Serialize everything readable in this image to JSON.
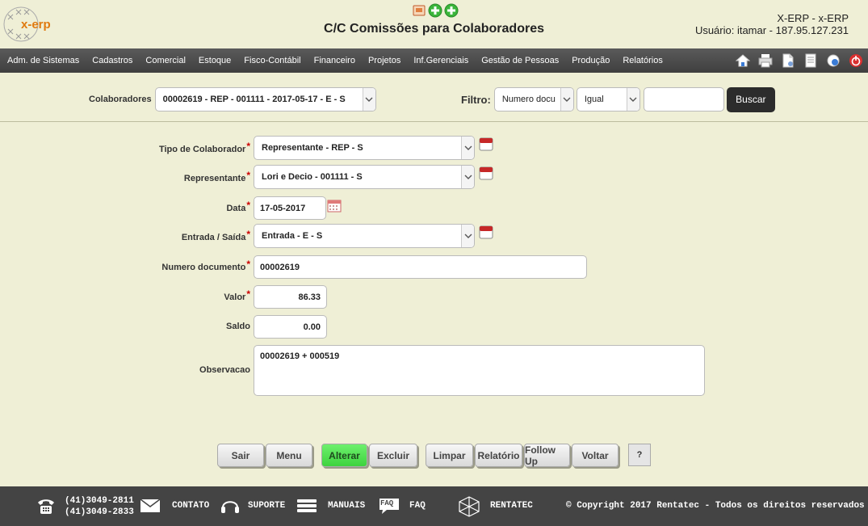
{
  "header": {
    "logo_text": "x-erp",
    "page_title": "C/C Comissões para Colaboradores",
    "system": "X-ERP - x-ERP",
    "user_info": "Usuário: itamar - 187.95.127.231"
  },
  "menu": {
    "items": [
      "Adm. de Sistemas",
      "Cadastros",
      "Comercial",
      "Estoque",
      "Fisco-Contábil",
      "Financeiro",
      "Projetos",
      "Inf.Gerenciais",
      "Gestão de Pessoas",
      "Produção",
      "Relatórios"
    ]
  },
  "filter": {
    "colaboradores_label": "Colaboradores",
    "colaboradores_value": "00002619 - REP - 001111 - 2017-05-17 - E - S",
    "filtro_label": "Filtro:",
    "field_value": "Numero docu",
    "operator_value": "Igual",
    "search_value": "",
    "buscar_label": "Buscar"
  },
  "form": {
    "tipo_label": "Tipo de Colaborador",
    "tipo_value": "Representante - REP - S",
    "representante_label": "Representante",
    "representante_value": "Lori e Decio - 001111 - S",
    "data_label": "Data",
    "data_value": "17-05-2017",
    "entrada_label": "Entrada / Saída",
    "entrada_value": "Entrada - E - S",
    "numero_label": "Numero documento",
    "numero_value": "00002619",
    "valor_label": "Valor",
    "valor_value": "86.33",
    "saldo_label": "Saldo",
    "saldo_value": "0.00",
    "obs_label": "Observacao",
    "obs_value": "00002619 + 000519",
    "required_mark": "*"
  },
  "actions": {
    "sair": "Sair",
    "menu": "Menu",
    "alterar": "Alterar",
    "excluir": "Excluir",
    "limpar": "Limpar",
    "relatorio": "Relatório",
    "followup": "Follow Up",
    "voltar": "Voltar",
    "help": "?"
  },
  "footer": {
    "phone1": "(41)3049-2811",
    "phone2": "(41)3049-2833",
    "contato": "CONTATO",
    "suporte": "SUPORTE",
    "manuais": "MANUAIS",
    "faq": "FAQ",
    "faq_icon_text": "FAQ",
    "rentatec": "RENTATEC",
    "copyright": "© Copyright 2017 Rentatec - Todos os direitos reservados"
  },
  "colors": {
    "background": "#efefd6",
    "menubar": "#4a4a4a",
    "alterar_button": "#4fe04f",
    "required": "#cc0000",
    "footer": "#444444"
  },
  "icons": {
    "top": [
      "document-icon",
      "add-icon",
      "add-icon"
    ],
    "menu_tools": [
      "home-icon",
      "print-icon",
      "document-icon",
      "page-icon",
      "help-globe-icon",
      "power-icon"
    ]
  }
}
